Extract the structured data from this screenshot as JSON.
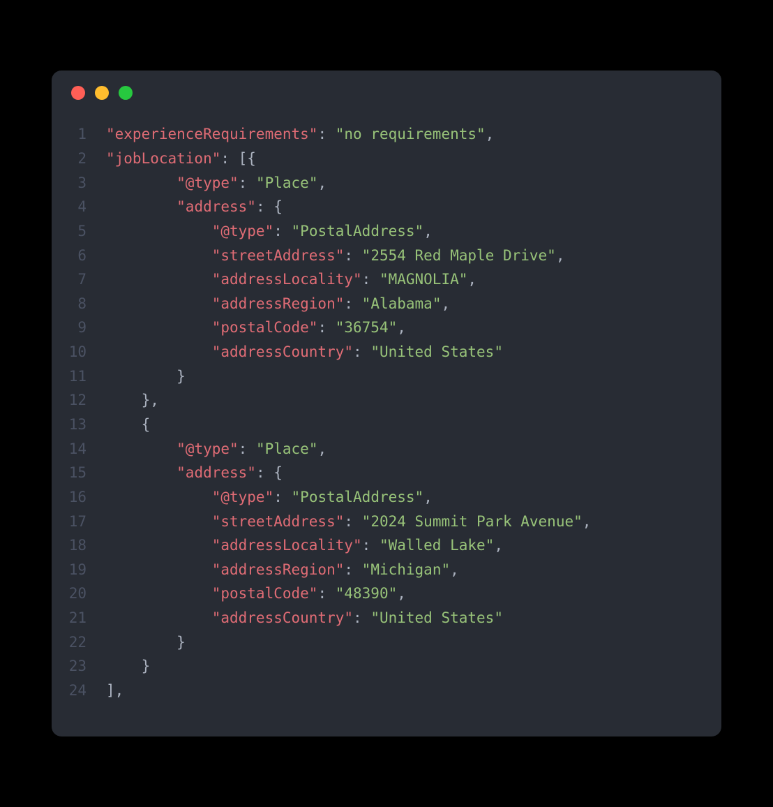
{
  "colors": {
    "background": "#000000",
    "window": "#282c34",
    "gutter": "#4b5263",
    "default": "#abb2bf",
    "key": "#e06c75",
    "string": "#98c379",
    "traffic_red": "#ff5f56",
    "traffic_yellow": "#ffbd2e",
    "traffic_green": "#27c93f"
  },
  "code": {
    "lines": [
      {
        "num": "1",
        "tokens": [
          {
            "cls": "key",
            "text": "\"experienceRequirements\""
          },
          {
            "cls": "punc",
            "text": ": "
          },
          {
            "cls": "str",
            "text": "\"no requirements\""
          },
          {
            "cls": "punc",
            "text": ","
          }
        ]
      },
      {
        "num": "2",
        "tokens": [
          {
            "cls": "key",
            "text": "\"jobLocation\""
          },
          {
            "cls": "punc",
            "text": ": [{"
          }
        ]
      },
      {
        "num": "3",
        "tokens": [
          {
            "cls": "punc",
            "text": "        "
          },
          {
            "cls": "key",
            "text": "\"@type\""
          },
          {
            "cls": "punc",
            "text": ": "
          },
          {
            "cls": "str",
            "text": "\"Place\""
          },
          {
            "cls": "punc",
            "text": ","
          }
        ]
      },
      {
        "num": "4",
        "tokens": [
          {
            "cls": "punc",
            "text": "        "
          },
          {
            "cls": "key",
            "text": "\"address\""
          },
          {
            "cls": "punc",
            "text": ": {"
          }
        ]
      },
      {
        "num": "5",
        "tokens": [
          {
            "cls": "punc",
            "text": "            "
          },
          {
            "cls": "key",
            "text": "\"@type\""
          },
          {
            "cls": "punc",
            "text": ": "
          },
          {
            "cls": "str",
            "text": "\"PostalAddress\""
          },
          {
            "cls": "punc",
            "text": ","
          }
        ]
      },
      {
        "num": "6",
        "tokens": [
          {
            "cls": "punc",
            "text": "            "
          },
          {
            "cls": "key",
            "text": "\"streetAddress\""
          },
          {
            "cls": "punc",
            "text": ": "
          },
          {
            "cls": "str",
            "text": "\"2554 Red Maple Drive\""
          },
          {
            "cls": "punc",
            "text": ","
          }
        ]
      },
      {
        "num": "7",
        "tokens": [
          {
            "cls": "punc",
            "text": "            "
          },
          {
            "cls": "key",
            "text": "\"addressLocality\""
          },
          {
            "cls": "punc",
            "text": ": "
          },
          {
            "cls": "str",
            "text": "\"MAGNOLIA\""
          },
          {
            "cls": "punc",
            "text": ","
          }
        ]
      },
      {
        "num": "8",
        "tokens": [
          {
            "cls": "punc",
            "text": "            "
          },
          {
            "cls": "key",
            "text": "\"addressRegion\""
          },
          {
            "cls": "punc",
            "text": ": "
          },
          {
            "cls": "str",
            "text": "\"Alabama\""
          },
          {
            "cls": "punc",
            "text": ","
          }
        ]
      },
      {
        "num": "9",
        "tokens": [
          {
            "cls": "punc",
            "text": "            "
          },
          {
            "cls": "key",
            "text": "\"postalCode\""
          },
          {
            "cls": "punc",
            "text": ": "
          },
          {
            "cls": "str",
            "text": "\"36754\""
          },
          {
            "cls": "punc",
            "text": ","
          }
        ]
      },
      {
        "num": "10",
        "tokens": [
          {
            "cls": "punc",
            "text": "            "
          },
          {
            "cls": "key",
            "text": "\"addressCountry\""
          },
          {
            "cls": "punc",
            "text": ": "
          },
          {
            "cls": "str",
            "text": "\"United States\""
          }
        ]
      },
      {
        "num": "11",
        "tokens": [
          {
            "cls": "punc",
            "text": "        }"
          }
        ]
      },
      {
        "num": "12",
        "tokens": [
          {
            "cls": "punc",
            "text": "    },"
          }
        ]
      },
      {
        "num": "13",
        "tokens": [
          {
            "cls": "punc",
            "text": "    {"
          }
        ]
      },
      {
        "num": "14",
        "tokens": [
          {
            "cls": "punc",
            "text": "        "
          },
          {
            "cls": "key",
            "text": "\"@type\""
          },
          {
            "cls": "punc",
            "text": ": "
          },
          {
            "cls": "str",
            "text": "\"Place\""
          },
          {
            "cls": "punc",
            "text": ","
          }
        ]
      },
      {
        "num": "15",
        "tokens": [
          {
            "cls": "punc",
            "text": "        "
          },
          {
            "cls": "key",
            "text": "\"address\""
          },
          {
            "cls": "punc",
            "text": ": {"
          }
        ]
      },
      {
        "num": "16",
        "tokens": [
          {
            "cls": "punc",
            "text": "            "
          },
          {
            "cls": "key",
            "text": "\"@type\""
          },
          {
            "cls": "punc",
            "text": ": "
          },
          {
            "cls": "str",
            "text": "\"PostalAddress\""
          },
          {
            "cls": "punc",
            "text": ","
          }
        ]
      },
      {
        "num": "17",
        "tokens": [
          {
            "cls": "punc",
            "text": "            "
          },
          {
            "cls": "key",
            "text": "\"streetAddress\""
          },
          {
            "cls": "punc",
            "text": ": "
          },
          {
            "cls": "str",
            "text": "\"2024 Summit Park Avenue\""
          },
          {
            "cls": "punc",
            "text": ","
          }
        ]
      },
      {
        "num": "18",
        "tokens": [
          {
            "cls": "punc",
            "text": "            "
          },
          {
            "cls": "key",
            "text": "\"addressLocality\""
          },
          {
            "cls": "punc",
            "text": ": "
          },
          {
            "cls": "str",
            "text": "\"Walled Lake\""
          },
          {
            "cls": "punc",
            "text": ","
          }
        ]
      },
      {
        "num": "19",
        "tokens": [
          {
            "cls": "punc",
            "text": "            "
          },
          {
            "cls": "key",
            "text": "\"addressRegion\""
          },
          {
            "cls": "punc",
            "text": ": "
          },
          {
            "cls": "str",
            "text": "\"Michigan\""
          },
          {
            "cls": "punc",
            "text": ","
          }
        ]
      },
      {
        "num": "20",
        "tokens": [
          {
            "cls": "punc",
            "text": "            "
          },
          {
            "cls": "key",
            "text": "\"postalCode\""
          },
          {
            "cls": "punc",
            "text": ": "
          },
          {
            "cls": "str",
            "text": "\"48390\""
          },
          {
            "cls": "punc",
            "text": ","
          }
        ]
      },
      {
        "num": "21",
        "tokens": [
          {
            "cls": "punc",
            "text": "            "
          },
          {
            "cls": "key",
            "text": "\"addressCountry\""
          },
          {
            "cls": "punc",
            "text": ": "
          },
          {
            "cls": "str",
            "text": "\"United States\""
          }
        ]
      },
      {
        "num": "22",
        "tokens": [
          {
            "cls": "punc",
            "text": "        }"
          }
        ]
      },
      {
        "num": "23",
        "tokens": [
          {
            "cls": "punc",
            "text": "    }"
          }
        ]
      },
      {
        "num": "24",
        "tokens": [
          {
            "cls": "punc",
            "text": "],"
          }
        ]
      }
    ]
  }
}
